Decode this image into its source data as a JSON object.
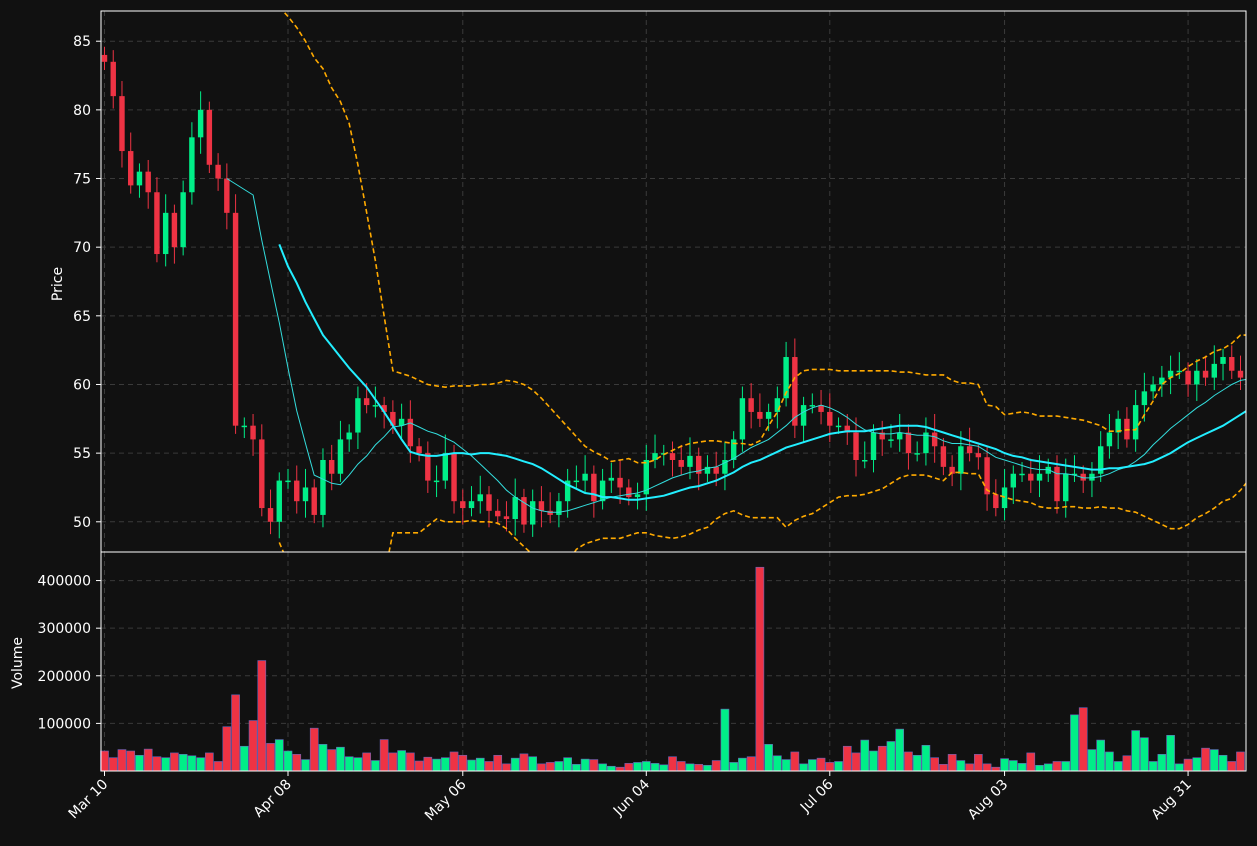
{
  "chart_data": {
    "type": "candlestick",
    "colors": {
      "background": "#111111",
      "up": "#00ee88",
      "down": "#ee3344",
      "ma_fast": "#33dddd",
      "ma_slow": "#22eeff",
      "band": "#ffaa00",
      "grid": "#3a3a3a",
      "frame": "#ffffff"
    },
    "x_tick_labels": [
      "Mar 10",
      "Apr 08",
      "May 06",
      "Jun 04",
      "Jul 06",
      "Aug 03",
      "Aug 31"
    ],
    "x_tick_index": [
      0,
      21,
      41,
      62,
      83,
      103,
      124
    ],
    "price_panel": {
      "ylabel": "Price",
      "ylim": [
        47.8,
        87.2
      ],
      "yticks": [
        50,
        55,
        60,
        65,
        70,
        75,
        80,
        85
      ],
      "grid": true
    },
    "volume_panel": {
      "ylabel": "Volume",
      "ylim": [
        0,
        460000
      ],
      "yticks": [
        100000,
        200000,
        300000,
        400000
      ],
      "grid": true
    },
    "series_overlays": [
      "moving average (fast)",
      "moving average (slow)",
      "upper band",
      "lower band"
    ],
    "n_points": 131,
    "close": [
      83.5,
      81.0,
      77.0,
      74.5,
      75.5,
      74.0,
      69.5,
      72.5,
      70.0,
      74.0,
      78.0,
      80.0,
      76.0,
      75.0,
      72.5,
      57.0,
      57.0,
      56.0,
      51.0,
      50.0,
      53.0,
      53.0,
      51.5,
      52.5,
      50.5,
      54.5,
      53.5,
      56.0,
      56.5,
      59.0,
      58.5,
      58.5,
      58.0,
      57.0,
      57.5,
      55.5,
      55.0,
      53.0,
      53.0,
      55.0,
      51.5,
      51.0,
      51.5,
      52.0,
      50.8,
      50.4,
      50.2,
      51.8,
      49.8,
      51.5,
      50.8,
      50.5,
      51.5,
      53.0,
      53.0,
      53.5,
      51.5,
      53.0,
      53.2,
      52.5,
      51.8,
      52.0,
      54.5,
      55.0,
      55.0,
      54.5,
      54.0,
      54.8,
      53.5,
      54.0,
      53.5,
      54.5,
      56.0,
      59.0,
      58.0,
      57.5,
      58.0,
      59.0,
      62.0,
      57.0,
      58.5,
      58.5,
      58.0,
      57.0,
      57.0,
      56.5,
      54.5,
      54.5,
      56.5,
      56.0,
      56.0,
      56.5,
      55.0,
      55.0,
      56.5,
      55.5,
      54.0,
      53.5,
      55.5,
      55.0,
      54.7,
      52.0,
      51.0,
      52.5,
      53.5,
      53.5,
      53.0,
      53.5,
      54.0,
      51.5,
      53.5,
      53.5,
      53.0,
      53.5,
      55.5,
      56.5,
      57.5,
      56.0,
      58.5,
      59.5,
      60.0,
      60.5,
      61.0,
      61.0,
      60.0,
      61.0,
      60.5,
      61.5,
      62.0,
      61.0,
      60.5
    ],
    "volume": [
      42000,
      28000,
      45000,
      42000,
      33000,
      46000,
      30000,
      28000,
      38000,
      35000,
      32000,
      28000,
      38000,
      20000,
      93000,
      160000,
      52000,
      106000,
      232000,
      58000,
      66000,
      42000,
      35000,
      24000,
      90000,
      56000,
      45000,
      50000,
      30000,
      28000,
      38000,
      22000,
      66000,
      38000,
      43000,
      38000,
      21000,
      29000,
      25000,
      28000,
      40000,
      33000,
      23000,
      27000,
      20000,
      33000,
      15000,
      27000,
      36000,
      30000,
      15000,
      18000,
      20000,
      28000,
      14000,
      25000,
      24000,
      15000,
      10000,
      8000,
      16000,
      18000,
      20000,
      16000,
      13000,
      30000,
      20000,
      15000,
      14000,
      12000,
      22000,
      130000,
      18000,
      27000,
      30000,
      428000,
      56000,
      32000,
      24000,
      40000,
      15000,
      24000,
      27000,
      18000,
      20000,
      52000,
      38000,
      65000,
      42000,
      52000,
      62000,
      88000,
      40000,
      33000,
      54000,
      28000,
      14000,
      35000,
      22000,
      15000,
      35000,
      15000,
      8000,
      26000,
      22000,
      16000,
      38000,
      12000,
      15000,
      20000,
      20000,
      118000,
      133000,
      45000,
      65000,
      40000,
      20000,
      32000,
      85000,
      70000,
      20000,
      35000,
      75000,
      15000,
      25000,
      28000,
      48000,
      45000,
      33000,
      20000,
      40000
    ],
    "ma_fast": [
      null,
      null,
      null,
      null,
      null,
      null,
      null,
      null,
      null,
      null,
      null,
      null,
      null,
      null,
      75.0,
      74.6,
      74.2,
      73.8,
      70.5,
      67.5,
      64.5,
      61.2,
      58.1,
      55.7,
      53.4,
      53.1,
      52.8,
      52.7,
      53.4,
      54.2,
      54.8,
      55.6,
      56.2,
      56.9,
      57.0,
      57.2,
      56.9,
      56.6,
      56.4,
      56.1,
      55.8,
      55.3,
      54.8,
      54.2,
      53.6,
      53.0,
      52.3,
      51.8,
      51.4,
      51.0,
      50.8,
      50.7,
      50.7,
      50.8,
      51.0,
      51.2,
      51.4,
      51.6,
      51.8,
      51.9,
      52.0,
      52.1,
      52.3,
      52.6,
      52.9,
      53.2,
      53.4,
      53.6,
      53.7,
      53.9,
      54.0,
      54.3,
      54.6,
      55.0,
      55.4,
      55.7,
      56.0,
      56.5,
      57.0,
      57.6,
      58.0,
      58.3,
      58.5,
      58.3,
      58.0,
      57.6,
      57.1,
      56.7,
      56.5,
      56.4,
      56.4,
      56.5,
      56.4,
      56.3,
      56.3,
      56.2,
      55.9,
      55.7,
      55.7,
      55.6,
      55.5,
      55.1,
      54.7,
      54.5,
      54.3,
      54.1,
      53.9,
      53.8,
      53.8,
      53.5,
      53.5,
      53.4,
      53.2,
      53.2,
      53.3,
      53.5,
      53.8,
      54.0,
      54.4,
      54.9,
      55.6,
      56.2,
      56.8,
      57.3,
      57.8,
      58.3,
      58.7,
      59.2,
      59.6,
      60.0,
      60.3,
      60.4
    ],
    "ma_slow": [
      null,
      null,
      null,
      null,
      null,
      null,
      null,
      null,
      null,
      null,
      null,
      null,
      null,
      null,
      null,
      null,
      null,
      null,
      null,
      null,
      70.2,
      68.6,
      67.4,
      66.0,
      64.8,
      63.6,
      62.8,
      62.0,
      61.2,
      60.5,
      59.8,
      58.9,
      58.0,
      57.0,
      56.0,
      55.1,
      54.9,
      54.8,
      54.8,
      54.9,
      55.0,
      55.0,
      54.9,
      55.0,
      55.0,
      54.9,
      54.8,
      54.6,
      54.4,
      54.2,
      53.9,
      53.5,
      53.1,
      52.7,
      52.4,
      52.1,
      52.0,
      51.8,
      51.8,
      51.7,
      51.6,
      51.6,
      51.7,
      51.8,
      51.9,
      52.1,
      52.3,
      52.5,
      52.6,
      52.8,
      53.0,
      53.3,
      53.6,
      54.0,
      54.3,
      54.5,
      54.8,
      55.1,
      55.4,
      55.6,
      55.8,
      56.0,
      56.2,
      56.4,
      56.5,
      56.6,
      56.6,
      56.6,
      56.7,
      56.8,
      56.9,
      57.0,
      57.0,
      57.0,
      56.9,
      56.7,
      56.5,
      56.3,
      56.1,
      55.9,
      55.7,
      55.5,
      55.3,
      55.0,
      54.8,
      54.7,
      54.5,
      54.4,
      54.3,
      54.2,
      54.1,
      54.0,
      53.9,
      53.8,
      53.8,
      53.9,
      53.9,
      54.0,
      54.1,
      54.2,
      54.4,
      54.7,
      55.0,
      55.4,
      55.8,
      56.1,
      56.4,
      56.7,
      57.0,
      57.4,
      57.8,
      58.2,
      58.4
    ],
    "band_upper": [
      null,
      null,
      null,
      null,
      null,
      null,
      null,
      null,
      null,
      null,
      null,
      null,
      null,
      null,
      null,
      null,
      null,
      null,
      null,
      null,
      87.5,
      86.8,
      86.0,
      85.0,
      83.8,
      83.0,
      81.6,
      80.6,
      79.0,
      76.0,
      72.5,
      69.0,
      65.0,
      61.0,
      60.8,
      60.6,
      60.3,
      60.0,
      59.9,
      59.8,
      59.9,
      59.9,
      59.9,
      60.0,
      60.0,
      60.1,
      60.3,
      60.2,
      60.0,
      59.6,
      59.0,
      58.3,
      57.6,
      56.9,
      56.2,
      55.5,
      55.1,
      54.8,
      54.4,
      54.5,
      54.6,
      54.3,
      54.3,
      54.5,
      54.9,
      55.2,
      55.5,
      55.7,
      55.8,
      55.9,
      55.9,
      55.8,
      55.7,
      55.7,
      55.6,
      55.9,
      57.0,
      58.0,
      59.4,
      60.5,
      61.0,
      61.1,
      61.1,
      61.1,
      61.0,
      61.0,
      61.0,
      61.0,
      61.0,
      61.0,
      61.0,
      60.9,
      60.9,
      60.8,
      60.7,
      60.7,
      60.7,
      60.3,
      60.1,
      60.1,
      60.0,
      58.5,
      58.4,
      57.8,
      57.9,
      58.0,
      57.9,
      57.7,
      57.7,
      57.7,
      57.6,
      57.5,
      57.4,
      57.2,
      57.0,
      56.6,
      56.6,
      56.7,
      56.7,
      57.8,
      58.8,
      60.0,
      60.5,
      60.8,
      61.3,
      61.7,
      62.0,
      62.4,
      62.6,
      63.0,
      63.6,
      63.6,
      63.6
    ],
    "band_lower": [
      null,
      null,
      null,
      null,
      null,
      null,
      null,
      null,
      null,
      null,
      null,
      null,
      null,
      null,
      null,
      null,
      null,
      null,
      null,
      null,
      48.5,
      47.0,
      45.0,
      43.0,
      41.0,
      39.0,
      38.5,
      38.0,
      37.5,
      38.0,
      40.0,
      43.0,
      46.0,
      49.2,
      49.2,
      49.2,
      49.2,
      49.7,
      50.2,
      50.0,
      50.0,
      50.0,
      50.1,
      50.0,
      50.0,
      49.9,
      49.5,
      48.8,
      48.2,
      47.6,
      47.0,
      46.6,
      46.6,
      47.0,
      48.0,
      48.4,
      48.6,
      48.8,
      48.8,
      48.8,
      49.0,
      49.2,
      49.2,
      49.0,
      48.9,
      48.8,
      48.9,
      49.1,
      49.4,
      49.6,
      50.2,
      50.6,
      50.8,
      50.5,
      50.3,
      50.3,
      50.3,
      50.3,
      49.6,
      50.1,
      50.4,
      50.6,
      51.0,
      51.4,
      51.8,
      51.9,
      51.9,
      52.0,
      52.2,
      52.4,
      52.8,
      53.2,
      53.4,
      53.4,
      53.4,
      53.2,
      53.0,
      53.6,
      53.6,
      53.5,
      53.5,
      52.3,
      52.0,
      51.8,
      51.6,
      51.5,
      51.4,
      51.1,
      51.0,
      51.0,
      51.1,
      51.1,
      51.0,
      51.0,
      51.1,
      51.0,
      51.0,
      50.8,
      50.7,
      50.4,
      50.1,
      49.8,
      49.5,
      49.5,
      49.8,
      50.3,
      50.6,
      51.0,
      51.5,
      51.7,
      52.3,
      53.1
    ]
  }
}
